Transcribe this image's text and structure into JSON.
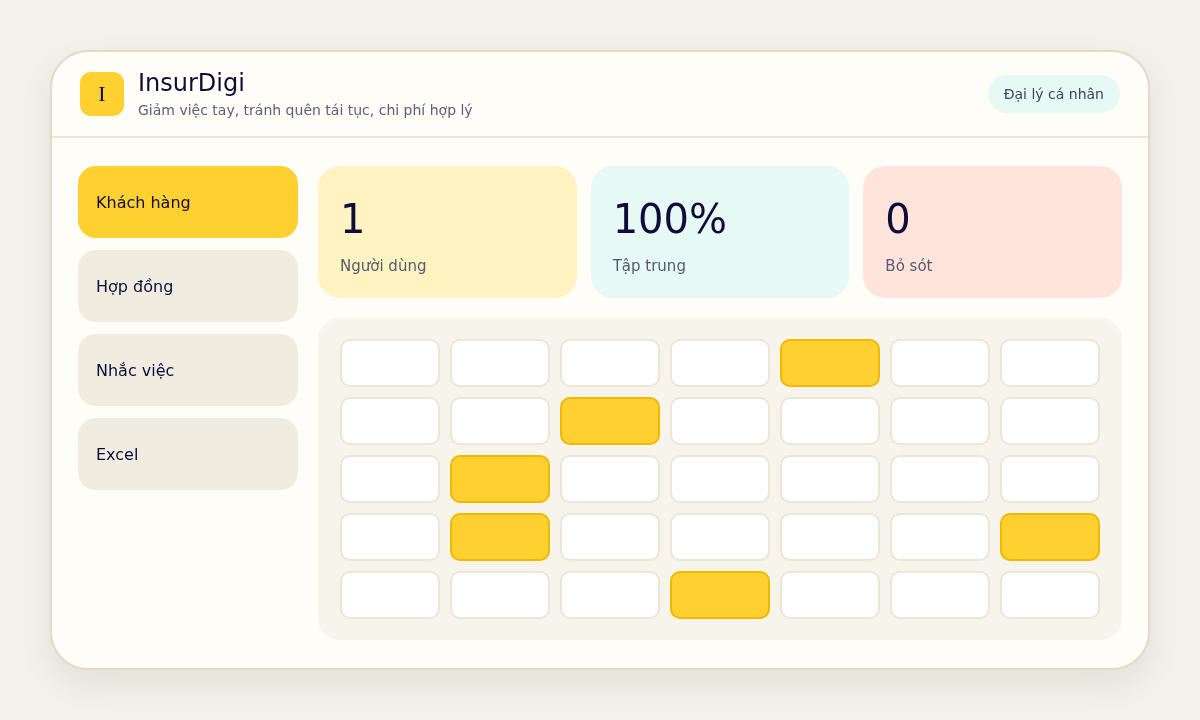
{
  "header": {
    "logo": {
      "letter": "I"
    },
    "title": "InsurDigi",
    "subtitle": "Giảm việc tay, tránh quên tái tục, chi phí hợp lý",
    "badge": "Đại lý cá nhân"
  },
  "sidebar": {
    "items": [
      {
        "label": "Khách hàng",
        "selected": true
      },
      {
        "label": "Hợp đồng",
        "selected": false
      },
      {
        "label": "Nhắc việc",
        "selected": false
      },
      {
        "label": "Excel",
        "selected": false
      }
    ]
  },
  "stats": [
    {
      "value": "1",
      "label": "Người dùng",
      "color": "#fff3c2"
    },
    {
      "value": "100%",
      "label": "Tập trung",
      "color": "#e6f9f4"
    },
    {
      "value": "0",
      "label": "Bỏ sót",
      "color": "#ffe4dc"
    }
  ],
  "grid": {
    "rows": [
      {
        "cells": [
          {
            "on": false
          },
          {
            "on": false
          },
          {
            "on": false
          },
          {
            "on": false
          },
          {
            "on": true
          },
          {
            "on": false
          },
          {
            "on": false
          }
        ]
      },
      {
        "cells": [
          {
            "on": false
          },
          {
            "on": false
          },
          {
            "on": true
          },
          {
            "on": false
          },
          {
            "on": false
          },
          {
            "on": false
          },
          {
            "on": false
          }
        ]
      },
      {
        "cells": [
          {
            "on": false
          },
          {
            "on": true
          },
          {
            "on": false
          },
          {
            "on": false
          },
          {
            "on": false
          },
          {
            "on": false
          },
          {
            "on": false
          }
        ]
      },
      {
        "cells": [
          {
            "on": false
          },
          {
            "on": true
          },
          {
            "on": false
          },
          {
            "on": false
          },
          {
            "on": false
          },
          {
            "on": false
          },
          {
            "on": true
          }
        ]
      },
      {
        "cells": [
          {
            "on": false
          },
          {
            "on": false
          },
          {
            "on": false
          },
          {
            "on": true
          },
          {
            "on": false
          },
          {
            "on": false
          },
          {
            "on": false
          }
        ]
      }
    ]
  }
}
